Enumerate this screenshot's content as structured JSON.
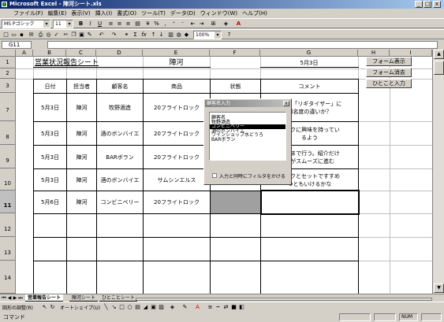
{
  "window": {
    "title": "Microsoft Excel - 陣河シート.xls",
    "min": "_",
    "max": "□",
    "close": "x"
  },
  "menu": [
    "ファイル(F)",
    "編集(E)",
    "表示(V)",
    "挿入(I)",
    "書式(O)",
    "ツール(T)",
    "データ(D)",
    "ウィンドウ(W)",
    "ヘルプ(H)"
  ],
  "toolbar": {
    "font": "MS Pゴシック",
    "size": "11",
    "zoom": "100%",
    "bold": "B",
    "italic": "I",
    "underline": "U",
    "help": "?",
    "sum": "Σ",
    "fx": "fx"
  },
  "formula": {
    "namebox": "G11",
    "content": ""
  },
  "columns": [
    "A",
    "B",
    "C",
    "D",
    "E",
    "F",
    "G",
    "H",
    "I"
  ],
  "rows": [
    "1",
    "2",
    "3",
    "7",
    "8",
    "9",
    "10",
    "11",
    "12",
    "13",
    "14"
  ],
  "sheet_title": "営業状況報告シート",
  "person_name": "陣河",
  "report_date": "5月3日",
  "headers": [
    "日付",
    "担当者",
    "顧客名",
    "商品",
    "状態",
    "コメント"
  ],
  "data_rows": [
    {
      "date": "5月3日",
      "person": "陣河",
      "customer": "牧野酒造",
      "product": "20フライトロック",
      "comment": "K社の「リギタイザー」に\n知名度の違いか？"
    },
    {
      "date": "5月3日",
      "person": "陣河",
      "customer": "酒のボンバイエ",
      "product": "20フライトロック",
      "comment": "ロックに興味を持ってい\nるよう"
    },
    {
      "date": "5月3日",
      "person": "陣河",
      "customer": "BARボラン",
      "product": "20フライトロック",
      "comment": "ゼンまで行う。紹介だけ\n話がスムーズに進む"
    },
    {
      "date": "5月3日",
      "person": "陣河",
      "customer": "酒のボンバイエ",
      "product": "サムシンエルス",
      "comment": "ロックとセットですすめ\nつともいけるかな"
    },
    {
      "date": "5月6日",
      "person": "陣河",
      "customer": "コンビニベリー",
      "product": "20フライトロック",
      "comment": ""
    }
  ],
  "form_buttons": [
    "フォーム表示",
    "フォーム消去",
    "ひとこと入力"
  ],
  "dialog": {
    "title": "顧客名入力",
    "close": "x",
    "items": [
      "顧客名",
      "牧野酒造",
      "コンビニベリー",
      "酒のボンバイエ",
      "ワインショップ水どうろ",
      "BARボラン"
    ],
    "selected_index": 2,
    "checkbox_label": "入力と同時にフィルタをかける"
  },
  "tabs": [
    "営業報告シート",
    "陣河シート",
    "ひとことシート"
  ],
  "drawing_bar": {
    "draw": "図形の調整(R)",
    "autoshape": "オートシェイプ(U)"
  },
  "status": {
    "text": "コマンド",
    "num": "NUM"
  },
  "colors": {
    "title_blue": "#0a246a",
    "selected_gray": "#a0a0a0"
  }
}
